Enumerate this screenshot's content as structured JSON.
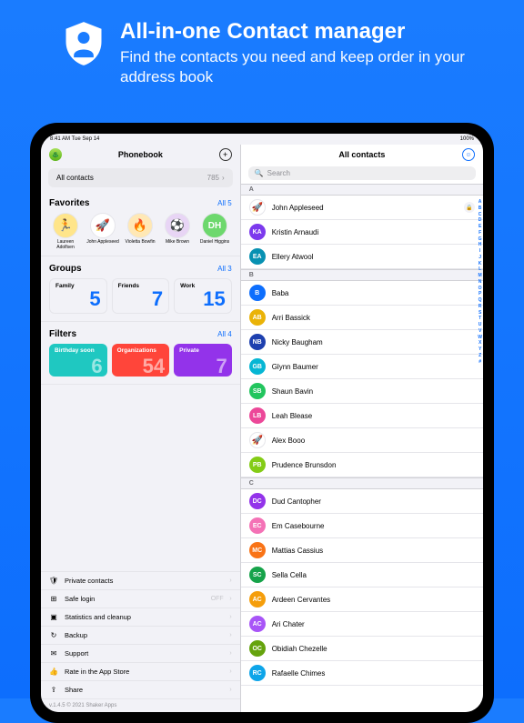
{
  "promo": {
    "title": "All-in-one Contact manager",
    "subtitle": "Find the contacts you need and keep order in your address book"
  },
  "statusbar": {
    "time": "8:41 AM   Tue Sep 14",
    "battery": "100%"
  },
  "left": {
    "title": "Phonebook",
    "all_contacts_label": "All contacts",
    "all_contacts_count": "785",
    "favorites": {
      "title": "Favorites",
      "link": "All 5",
      "items": [
        {
          "name": "Laureen Adolfsen",
          "emoji": "🏃",
          "bg": "#ffe58a"
        },
        {
          "name": "John Appleseed",
          "emoji": "🚀",
          "bg": "#ffffff"
        },
        {
          "name": "Violetta Bowfin",
          "emoji": "🔥",
          "bg": "#ffe8b5"
        },
        {
          "name": "Mike Brown",
          "emoji": "⚽",
          "bg": "#e8d5f5"
        },
        {
          "name": "Daniel Higgins",
          "initials": "DH",
          "bg": "#6dd86d"
        }
      ]
    },
    "groups": {
      "title": "Groups",
      "link": "All 3",
      "items": [
        {
          "label": "Family",
          "count": "5"
        },
        {
          "label": "Friends",
          "count": "7"
        },
        {
          "label": "Work",
          "count": "15"
        }
      ]
    },
    "filters": {
      "title": "Filters",
      "link": "All 4",
      "items": [
        {
          "label": "Birthday soon",
          "count": "6",
          "bg": "#1fc8c1"
        },
        {
          "label": "Organizations",
          "count": "54",
          "bg": "#ff453a"
        },
        {
          "label": "Private",
          "count": "7",
          "bg": "#9333ea"
        }
      ]
    },
    "menu": [
      {
        "icon": "🛡",
        "label": "Private contacts"
      },
      {
        "icon": "⊞",
        "label": "Safe login",
        "suffix": "OFF"
      },
      {
        "icon": "▣",
        "label": "Statistics and cleanup"
      },
      {
        "icon": "↻",
        "label": "Backup"
      },
      {
        "icon": "✉",
        "label": "Support"
      },
      {
        "icon": "👍",
        "label": "Rate in the App Store"
      },
      {
        "icon": "⇪",
        "label": "Share"
      }
    ],
    "footer": "v.1.4.5 © 2021 Shaker Apps"
  },
  "right": {
    "title": "All contacts",
    "search_placeholder": "Search",
    "sections": [
      {
        "letter": "A",
        "contacts": [
          {
            "name": "John Appleseed",
            "emoji": "🚀",
            "bg": "#ffffff",
            "locked": true
          },
          {
            "name": "Kristin Arnaudi",
            "initials": "KA",
            "bg": "#7c3aed"
          },
          {
            "name": "Ellery Atwool",
            "initials": "EA",
            "bg": "#0891b2"
          }
        ]
      },
      {
        "letter": "B",
        "contacts": [
          {
            "name": "Baba",
            "initials": "B",
            "bg": "#0d6efd"
          },
          {
            "name": "Arri Bassick",
            "initials": "AB",
            "bg": "#eab308"
          },
          {
            "name": "Nicky Baugham",
            "initials": "NB",
            "bg": "#1e40af"
          },
          {
            "name": "Glynn Baumer",
            "initials": "GB",
            "bg": "#06b6d4"
          },
          {
            "name": "Shaun Bavin",
            "initials": "SB",
            "bg": "#22c55e"
          },
          {
            "name": "Leah Blease",
            "initials": "LB",
            "bg": "#ec4899"
          },
          {
            "name": "Alex Booo",
            "emoji": "🚀",
            "bg": "#ffffff"
          },
          {
            "name": "Prudence Brunsdon",
            "initials": "PB",
            "bg": "#84cc16"
          }
        ]
      },
      {
        "letter": "C",
        "contacts": [
          {
            "name": "Dud Cantopher",
            "initials": "DC",
            "bg": "#9333ea"
          },
          {
            "name": "Em Casebourne",
            "initials": "EC",
            "bg": "#f472b6"
          },
          {
            "name": "Mattias Cassius",
            "initials": "MC",
            "bg": "#f97316"
          },
          {
            "name": "Sella Cella",
            "initials": "SC",
            "bg": "#16a34a"
          },
          {
            "name": "Ardeen Cervantes",
            "initials": "AC",
            "bg": "#f59e0b"
          },
          {
            "name": "Ari Chater",
            "initials": "AC",
            "bg": "#a855f7"
          },
          {
            "name": "Obidiah Chezelle",
            "initials": "OC",
            "bg": "#65a30d"
          },
          {
            "name": "Rafaelle Chimes",
            "initials": "RC",
            "bg": "#0ea5e9"
          }
        ]
      }
    ],
    "index": [
      "A",
      "B",
      "C",
      "D",
      "E",
      "F",
      "G",
      "H",
      "I",
      "J",
      "K",
      "L",
      "M",
      "N",
      "O",
      "P",
      "Q",
      "R",
      "S",
      "T",
      "U",
      "V",
      "W",
      "X",
      "Y",
      "Z",
      "#"
    ]
  }
}
